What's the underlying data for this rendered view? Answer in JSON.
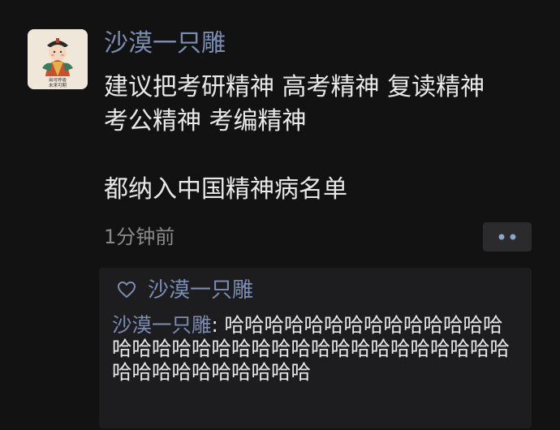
{
  "post": {
    "author": "沙漠一只雕",
    "avatar_text": [
      "尚可呼吸",
      "未来可期"
    ],
    "content_lines": [
      "建议把考研精神 高考精神 复读精神",
      "考公精神 考编精神",
      "",
      "都纳入中国精神病名单"
    ],
    "timestamp": "1分钟前",
    "more_icon": "more-dots-icon"
  },
  "interactions": {
    "like_icon": "heart-outline-icon",
    "likers": "沙漠一只雕",
    "comments": [
      {
        "author": "沙漠一只雕",
        "separator": ": ",
        "text": "哈哈哈哈哈哈哈哈哈哈哈哈哈哈哈哈哈哈哈哈哈哈哈哈哈哈哈哈哈哈哈哈哈哈哈哈哈哈哈哈哈哈哈哈"
      }
    ]
  },
  "colors": {
    "background": "#121212",
    "name_link": "#7c8db4",
    "body_text": "#e9e9e9",
    "meta_text": "#8a8a8a",
    "panel_bg": "#1d1d20",
    "button_bg": "#2b2b2d"
  }
}
